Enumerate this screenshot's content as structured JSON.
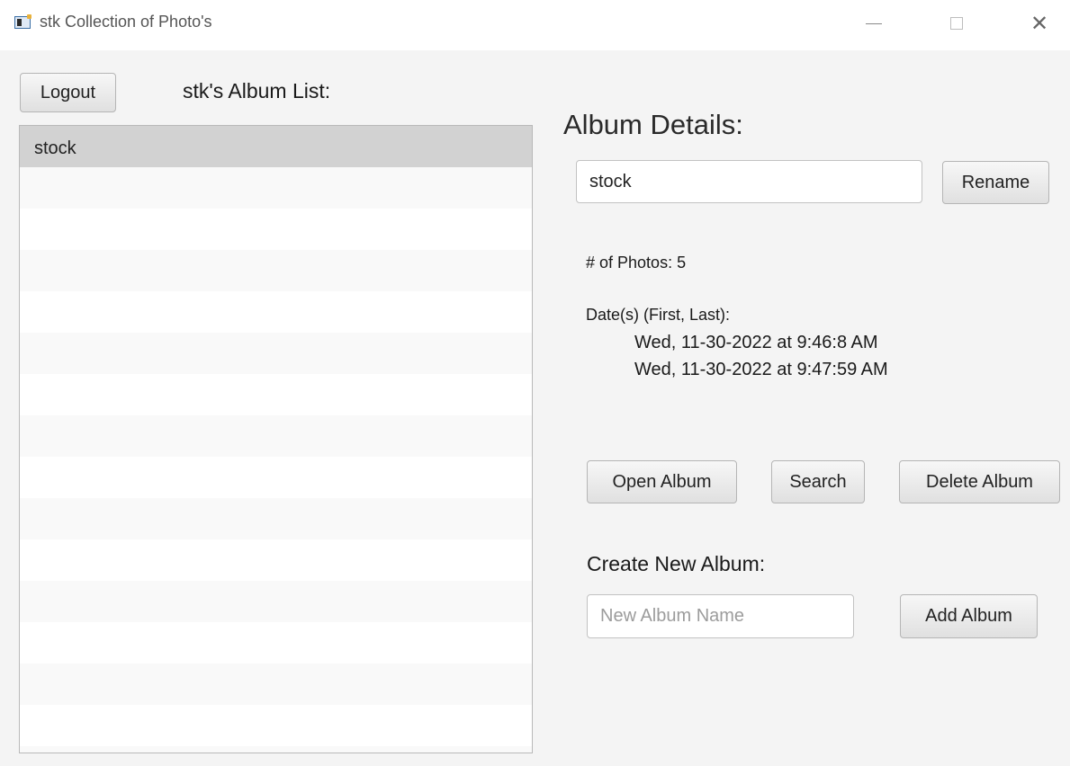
{
  "window": {
    "title": "stk Collection of Photo's",
    "minimize_symbol": "—",
    "close_symbol": "✕"
  },
  "left": {
    "logout_label": "Logout",
    "list_heading": "stk's Album List:",
    "albums": [
      "stock"
    ],
    "selected_index": 0
  },
  "details": {
    "heading": "Album Details:",
    "album_name_value": "stock",
    "rename_label": "Rename",
    "photo_count_text": "# of Photos: 5",
    "dates_label": "Date(s) (First, Last):",
    "first_date": "Wed, 11-30-2022 at 9:46:8 AM",
    "last_date": "Wed, 11-30-2022 at 9:47:59 AM",
    "open_album_label": "Open Album",
    "search_label": "Search",
    "delete_album_label": "Delete Album"
  },
  "create": {
    "heading": "Create New Album:",
    "placeholder": "New Album Name",
    "value": "",
    "add_album_label": "Add Album"
  },
  "icons": {
    "app": "app-window-icon",
    "minimize": "minimize-icon",
    "maximize": "maximize-icon",
    "close": "close-icon"
  },
  "colors": {
    "selected_row": "#d2d2d2",
    "background": "#f4f4f4"
  }
}
